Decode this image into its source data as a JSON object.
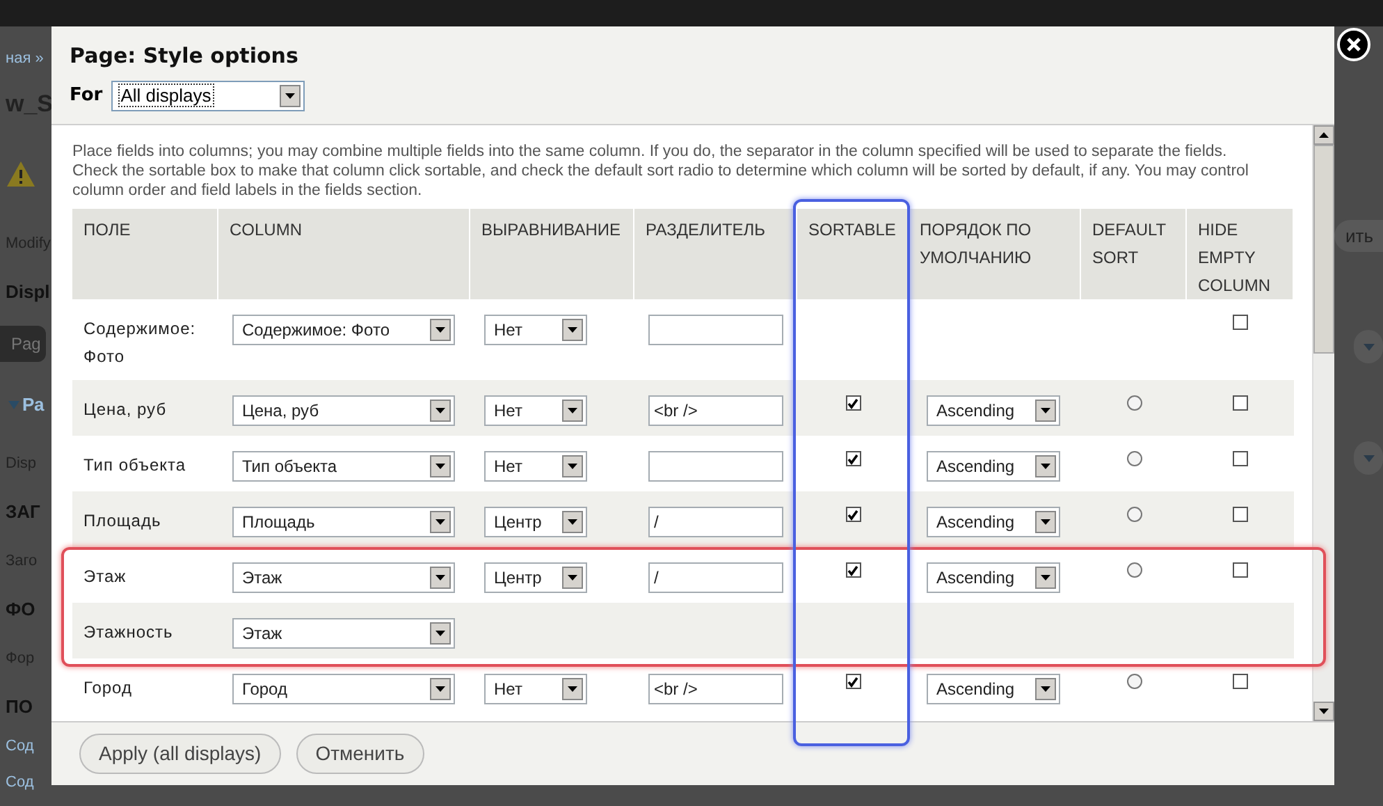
{
  "background": {
    "left": [
      {
        "kind": "link",
        "text": "ная »"
      },
      {
        "kind": "title",
        "text": "w_S"
      },
      {
        "kind": "warning"
      },
      {
        "kind": "text",
        "text": "Modify"
      },
      {
        "kind": "heading",
        "text": "Displ"
      },
      {
        "kind": "pill",
        "text": "Pag"
      },
      {
        "kind": "fieldset",
        "text": "Ра"
      },
      {
        "kind": "text",
        "text": "Disp"
      },
      {
        "kind": "heading",
        "text": "ЗАГ"
      },
      {
        "kind": "text",
        "text": "Заго"
      },
      {
        "kind": "heading",
        "text": "ФО"
      },
      {
        "kind": "text",
        "text": "Фор"
      },
      {
        "kind": "heading",
        "text": "ПО"
      },
      {
        "kind": "link",
        "text": "Сод"
      },
      {
        "kind": "link",
        "text": "Сод"
      }
    ],
    "right": [
      {
        "kind": "button",
        "text": "ить"
      },
      {
        "kind": "dropdown"
      },
      {
        "kind": "dropdown"
      }
    ]
  },
  "dialog": {
    "title": "Page: Style options",
    "for_label": "For",
    "for_value": "All displays",
    "description": "Place fields into columns; you may combine multiple fields into the same column. If you do, the separator in the column specified will be used to separate the fields. Check the sortable box to make that column click sortable, and check the default sort radio to determine which column will be sorted by default, if any. You may control column order and field labels in the fields section.",
    "columns": [
      "ПОЛЕ",
      "COLUMN",
      "ВЫРАВНИВАНИЕ",
      "РАЗДЕЛИТЕЛЬ",
      "SORTABLE",
      "ПОРЯДОК ПО УМОЛЧАНИЮ",
      "DEFAULT SORT",
      "HIDE EMPTY COLUMN"
    ],
    "rows": [
      {
        "kind": "plain",
        "field": "Содержимое: Фото",
        "column": "Содержимое: Фото",
        "align": "Нет",
        "hide_empty": false
      },
      {
        "kind": "sortable",
        "field": "Цена, руб",
        "column": "Цена, руб",
        "align": "Нет",
        "separator": "<br />",
        "sortable": true,
        "order": "Ascending",
        "default_sort": {
          "selected": false
        },
        "hide_empty": false
      },
      {
        "kind": "sortable",
        "field": "Тип объекта",
        "column": "Тип объекта",
        "align": "Нет",
        "sortable": true,
        "order": "Ascending",
        "default_sort": {
          "selected": false
        },
        "hide_empty": false
      },
      {
        "kind": "sortable",
        "field": "Площадь",
        "column": "Площадь",
        "align": "Центр",
        "separator": "/",
        "sortable": true,
        "order": "Ascending",
        "default_sort": {
          "selected": false
        },
        "hide_empty": false
      },
      {
        "kind": "sortable",
        "field": "Этаж",
        "column": "Этаж",
        "align": "Центр",
        "separator": "/",
        "sortable": true,
        "order": "Ascending",
        "default_sort": {
          "selected": false
        },
        "hide_empty": false
      },
      {
        "kind": "merged",
        "field": "Этажность",
        "column": "Этаж"
      },
      {
        "kind": "sortable",
        "field": "Город",
        "column": "Город",
        "align": "Нет",
        "separator": "<br />",
        "sortable": true,
        "order": "Ascending",
        "default_sort": {
          "selected": false
        },
        "hide_empty": false
      }
    ],
    "buttons": [
      "Apply (all displays)",
      "Отменить"
    ]
  }
}
